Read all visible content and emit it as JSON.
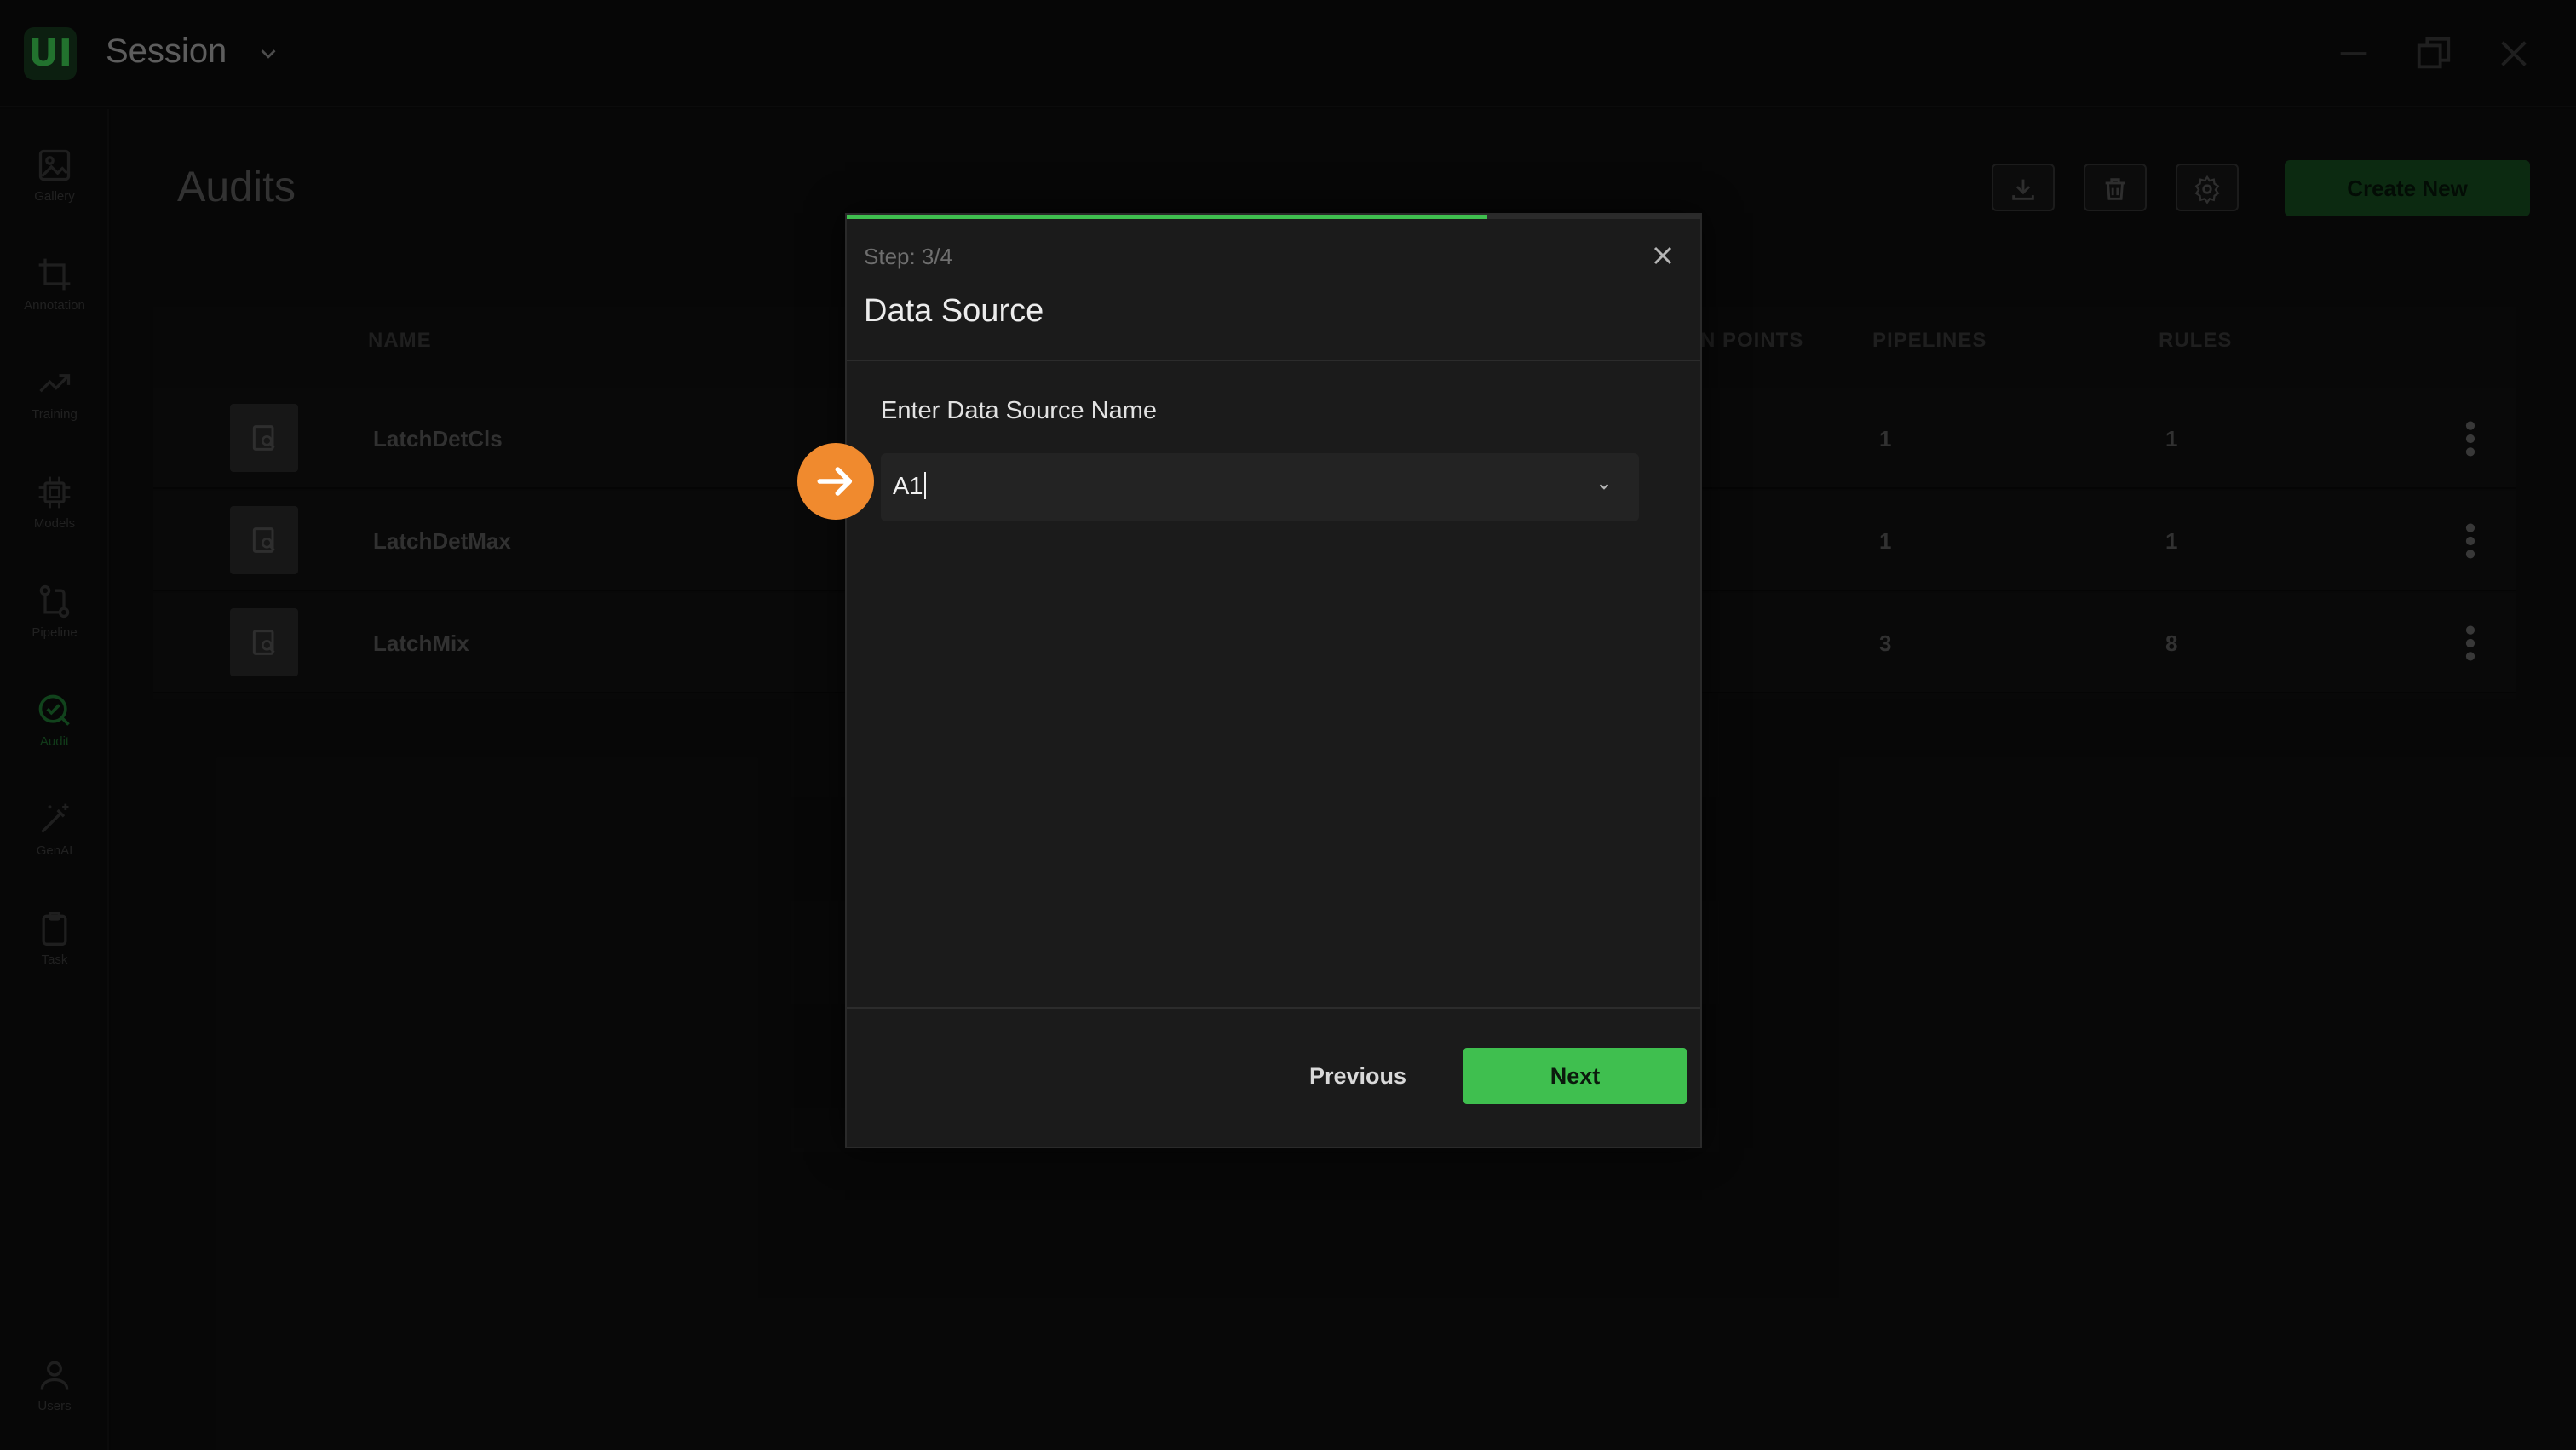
{
  "window": {
    "app_logo": "UI",
    "session_title": "Session",
    "icons": [
      "chevron-down-icon",
      "minimize-icon",
      "restore-icon",
      "close-icon"
    ]
  },
  "sidebar": {
    "items": [
      {
        "label": "Gallery",
        "icon": "image-icon"
      },
      {
        "label": "Annotation",
        "icon": "crop-icon"
      },
      {
        "label": "Training",
        "icon": "trend-icon"
      },
      {
        "label": "Models",
        "icon": "chip-icon"
      },
      {
        "label": "Pipeline",
        "icon": "pipeline-icon"
      },
      {
        "label": "Audit",
        "icon": "audit-icon",
        "active": true
      },
      {
        "label": "GenAI",
        "icon": "magic-wand-icon"
      },
      {
        "label": "Task",
        "icon": "clipboard-icon"
      }
    ],
    "footer": {
      "label": "Users",
      "icon": "user-icon"
    }
  },
  "page": {
    "title": "Audits",
    "create_label": "Create New",
    "toolbar_icons": [
      "download-icon",
      "trash-icon",
      "gear-icon"
    ]
  },
  "table": {
    "headers": {
      "name": "NAME",
      "points": "N POINTS",
      "pipelines": "PIPELINES",
      "rules": "RULES"
    },
    "rows": [
      {
        "name": "LatchDetCls",
        "pipelines": "1",
        "rules": "1"
      },
      {
        "name": "LatchDetMax",
        "pipelines": "1",
        "rules": "1"
      },
      {
        "name": "LatchMix",
        "pipelines": "3",
        "rules": "8"
      }
    ]
  },
  "modal": {
    "step": "Step: 3/4",
    "progress": 0.75,
    "title": "Data Source",
    "field_label": "Enter Data Source Name",
    "field_value": "A1",
    "previous_label": "Previous",
    "next_label": "Next"
  },
  "colors": {
    "accent": "#3fbf4f",
    "marker": "#f08a2e",
    "modal_bg": "#1b1b1b",
    "page_bg": "#0e0e0e"
  }
}
